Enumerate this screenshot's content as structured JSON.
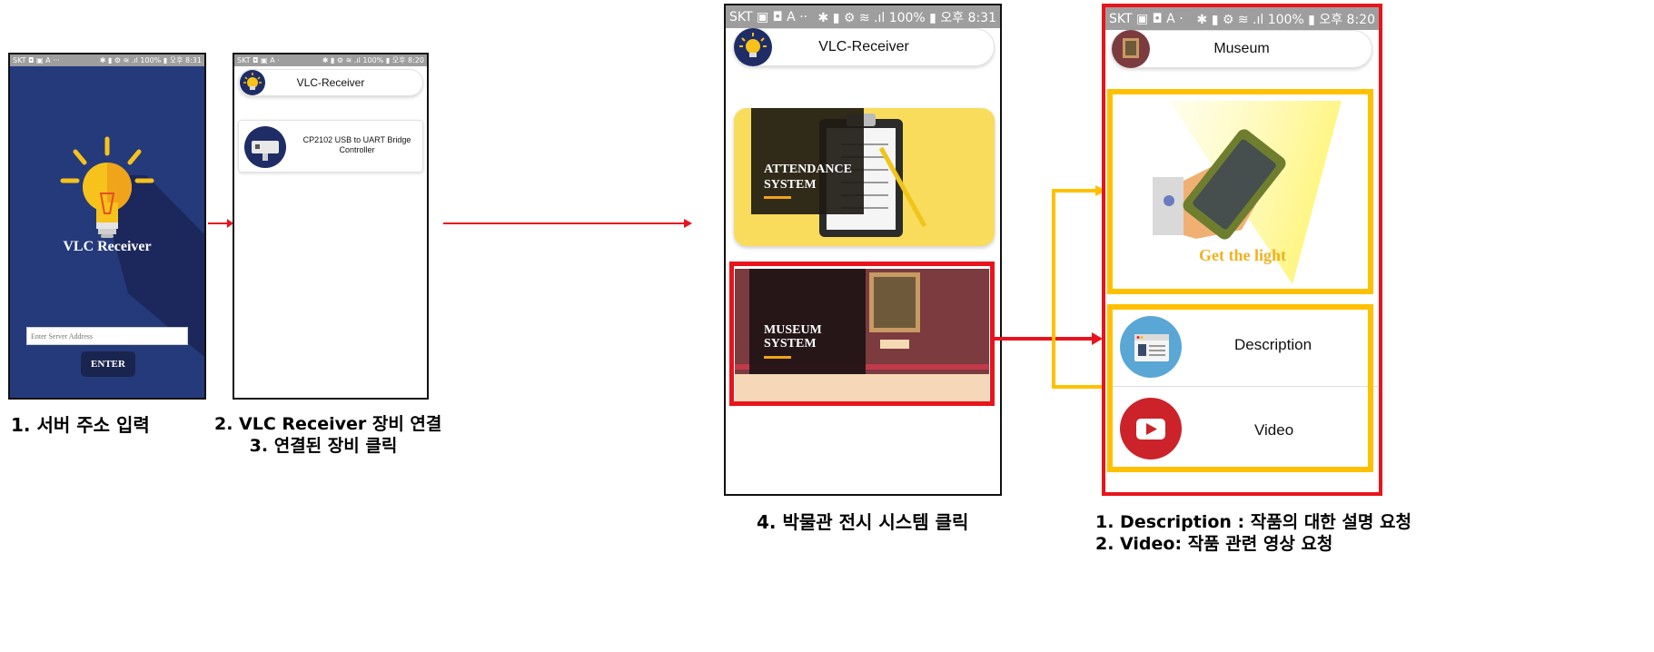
{
  "status_bar": {
    "s1": {
      "left": "SKT ◘ ▣ A ···",
      "right": "✱ ▮ ⚙ ≋ .ıl 100% ▮ 오후 8:31"
    },
    "s2": {
      "left": "SKT ◘ ▣ A ·",
      "right": "✱ ▮ ⚙ ≋ .ıl 100% ▮ 오후 8:20"
    },
    "s3": {
      "left": "SKT ▣ ◘ A ··",
      "right": "✱ ▮ ⚙ ≋ .ıl 100% ▮ 오후 8:31"
    },
    "s4": {
      "left": "SKT ▣ ◘ A ·",
      "right": "✱ ▮ ⚙ ≋ .ıl 100% ▮ 오후 8:20"
    }
  },
  "screen1": {
    "app_title": "VLC Receiver",
    "server_input_placeholder": "Enter Server Address",
    "enter_button": "ENTER",
    "caption": "1. 서버 주소 입력"
  },
  "screen2": {
    "app_title": "VLC-Receiver",
    "device_name": "CP2102 USB to UART Bridge Controller",
    "caption_line1": "2. VLC Receiver 장비 연결",
    "caption_line2": "3. 연결된 장비 클릭"
  },
  "screen3": {
    "app_title": "VLC-Receiver",
    "card_attendance_line1": "ATTENDANCE",
    "card_attendance_line2": "SYSTEM",
    "card_museum_line1": "MUSEUM",
    "card_museum_line2": "SYSTEM",
    "caption": "4. 박물관 전시 시스템 클릭"
  },
  "screen4": {
    "app_title": "Museum",
    "banner_text": "Get the light",
    "description_label": "Description",
    "video_label": "Video",
    "caption_line1": "1. Description : 작품의 대한 설명 요청",
    "caption_line2": "2. Video: 작품 관련 영상 요청"
  },
  "colors": {
    "highlight_red": "#e8141c",
    "highlight_yellow": "#ffc000",
    "screen1_background": "#253a7a",
    "attendance_card": "#f9dc5c",
    "museum_card": "#7b3b3f"
  }
}
